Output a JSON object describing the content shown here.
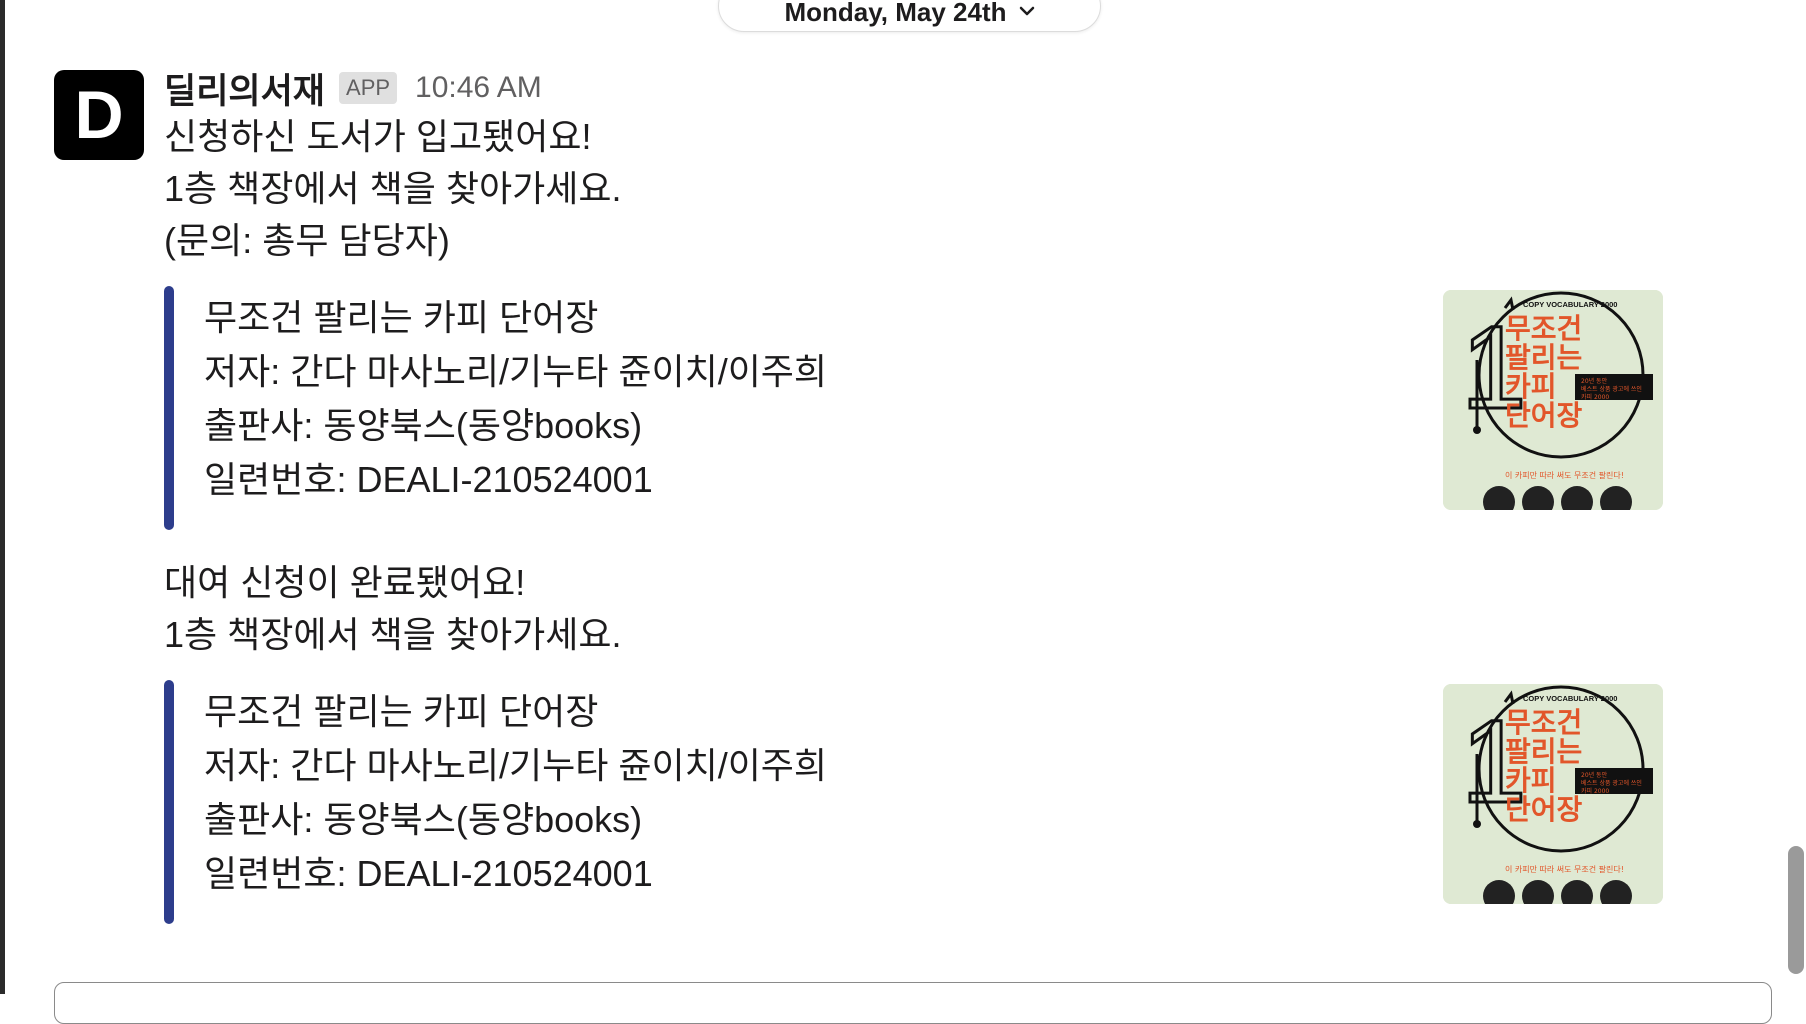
{
  "date_divider": {
    "label": "Monday, May 24th"
  },
  "message": {
    "avatar_letter": "D",
    "sender": "딜리의서재",
    "badge": "APP",
    "time": "10:46 AM",
    "blocks": [
      {
        "lines": [
          "신청하신 도서가 입고됐어요!",
          "1층 책장에서 책을 찾아가세요.",
          "(문의: 총무 담당자)"
        ],
        "attachment": {
          "title": "무조건 팔리는 카피 단어장",
          "author": "저자: 간다 마사노리/기누타 쥰이치/이주희",
          "publisher": "출판사: 동양북스(동양books)",
          "serial": "일련번호: DEALI-210524001",
          "cover": {
            "big_numeral": "1",
            "top_label": "COPY VOCABULARY 2000",
            "title_lines": [
              "무조건",
              "팔리는",
              "카피",
              "단어장"
            ],
            "sub_box": [
              "20년 동안",
              "베스트 상품 광고에 쓰인",
              "카피 2000"
            ],
            "bottom_tag": "이 카피만 따라 써도 무조건 팔린다!",
            "accent_color": "#e2562a",
            "bg_color": "#dfe9d3"
          }
        }
      },
      {
        "lines": [
          "대여 신청이 완료됐어요!",
          "1층 책장에서 책을 찾아가세요."
        ],
        "attachment": {
          "title": "무조건 팔리는 카피 단어장",
          "author": "저자: 간다 마사노리/기누타 쥰이치/이주희",
          "publisher": "출판사: 동양북스(동양books)",
          "serial": "일련번호: DEALI-210524001",
          "cover": {
            "big_numeral": "1",
            "top_label": "COPY VOCABULARY 2000",
            "title_lines": [
              "무조건",
              "팔리는",
              "카피",
              "단어장"
            ],
            "sub_box": [
              "20년 동안",
              "베스트 상품 광고에 쓰인",
              "카피 2000"
            ],
            "bottom_tag": "이 카피만 따라 써도 무조건 팔린다!",
            "accent_color": "#e2562a",
            "bg_color": "#dfe9d3"
          }
        }
      }
    ]
  },
  "colors": {
    "attachment_bar": "#2d3d8c",
    "muted_text": "#616061"
  }
}
